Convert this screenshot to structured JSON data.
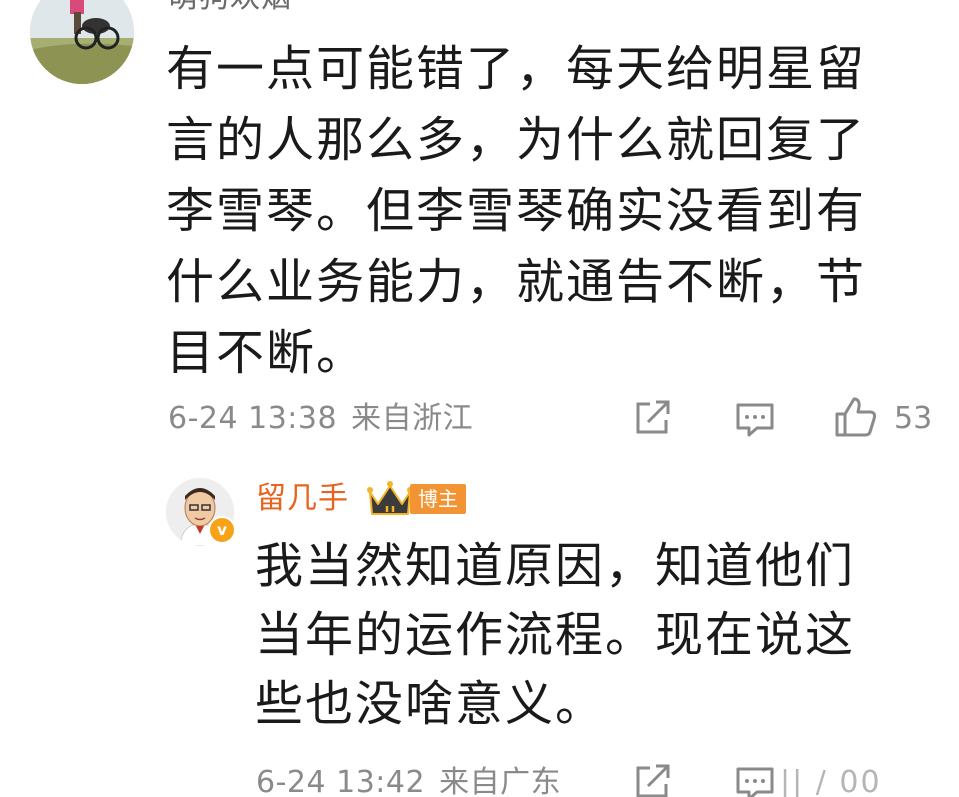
{
  "comment": {
    "username": "萌狗欢烟",
    "text": "有一点可能错了，每天给明星留\n言的人那么多，为什么就回复了\n李雪琴。但李雪琴确实没看到有\n什么业务能力，就通告不断，节\n目不断。",
    "time": "6-24 13:38",
    "location": "来自浙江",
    "likes": "53",
    "icons": [
      "share-icon",
      "comment-icon",
      "like-icon"
    ]
  },
  "reply": {
    "username": "留几手",
    "badge": "博主",
    "verified_mark": "v",
    "text": "我当然知道原因，知道他们\n当年的运作流程。现在说这\n些也没啥意义。",
    "time": "6-24 13:42",
    "location": "来自广东",
    "icons": [
      "crown-icon",
      "share-icon",
      "comment-icon"
    ]
  },
  "watermark": "|| / 00",
  "colors": {
    "text": "#1a1a1a",
    "meta": "#8a8a8a",
    "author_name": "#e8631d",
    "badge_bg": "#f29433",
    "verified": "#f7a318"
  }
}
